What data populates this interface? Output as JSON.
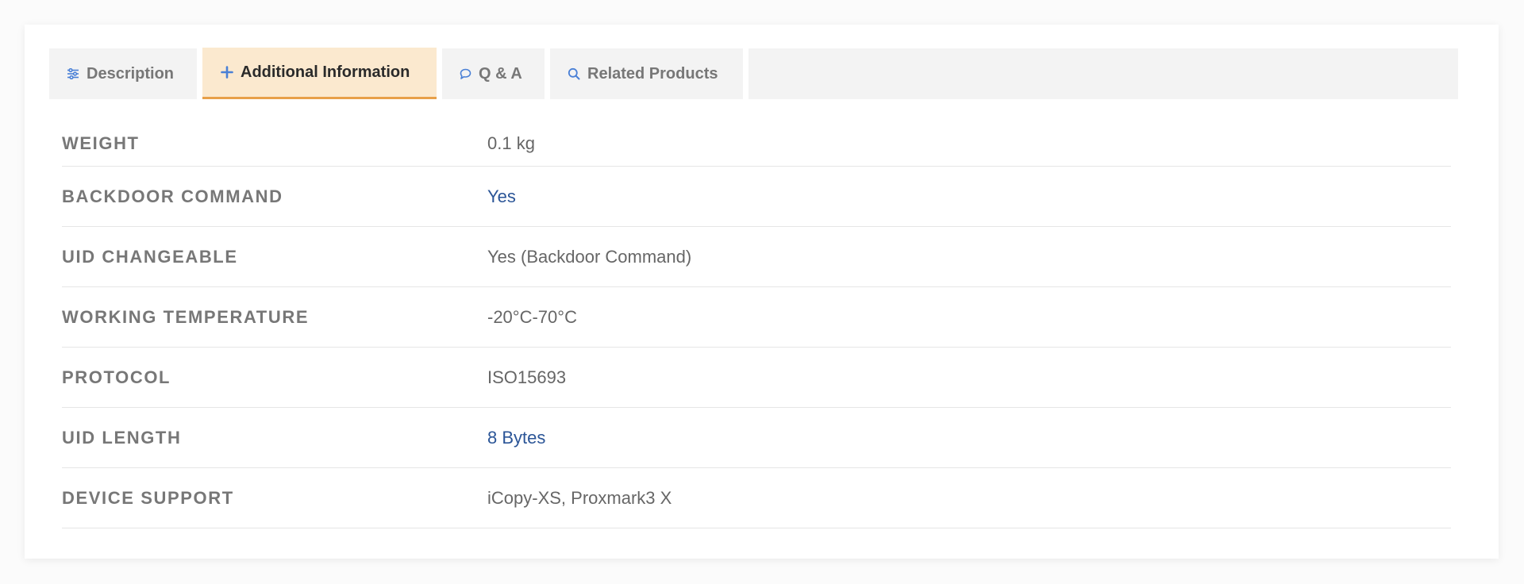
{
  "tabs": {
    "description": {
      "label": "Description",
      "icon": "sliders-icon"
    },
    "additional": {
      "label": "Additional Information",
      "icon": "plus-icon",
      "active": true
    },
    "qa": {
      "label": "Q & A",
      "icon": "speech-bubble-icon"
    },
    "related": {
      "label": "Related Products",
      "icon": "search-icon"
    }
  },
  "specs": [
    {
      "label": "WEIGHT",
      "value": "0.1 kg",
      "link": false
    },
    {
      "label": "BACKDOOR COMMAND",
      "value": "Yes",
      "link": true
    },
    {
      "label": "UID CHANGEABLE",
      "value": "Yes (Backdoor Command)",
      "link": false
    },
    {
      "label": "WORKING TEMPERATURE",
      "value": "-20°C-70°C",
      "link": false
    },
    {
      "label": "PROTOCOL",
      "value": "ISO15693",
      "link": false
    },
    {
      "label": "UID LENGTH",
      "value": "8 Bytes",
      "link": true
    },
    {
      "label": "DEVICE SUPPORT",
      "value": "iCopy-XS, Proxmark3 X",
      "link": false
    }
  ],
  "colors": {
    "active_tab_bg": "#fbe9cf",
    "active_tab_underline": "#e8a049",
    "link": "#2b5597",
    "icon_accent": "#4a80d6"
  }
}
